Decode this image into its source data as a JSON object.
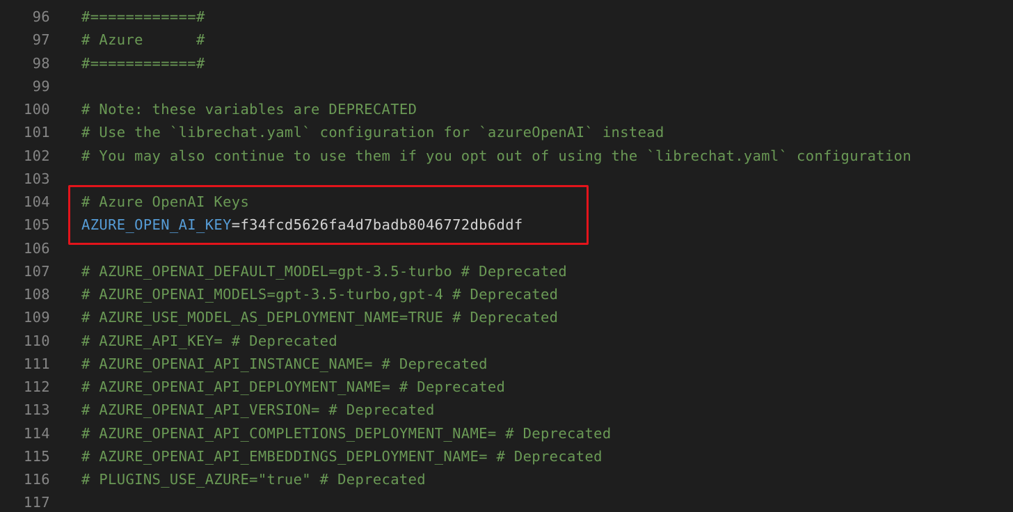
{
  "colors": {
    "background": "#1e1e1e",
    "line_number": "#858585",
    "comment": "#6a9955",
    "variable": "#569cd6",
    "text": "#d4d4d4",
    "highlight_border": "#e3141b"
  },
  "lines": [
    {
      "num": "96",
      "parts": [
        {
          "text": "#============#",
          "kind": "comment"
        }
      ]
    },
    {
      "num": "97",
      "parts": [
        {
          "text": "# Azure      #",
          "kind": "comment"
        }
      ]
    },
    {
      "num": "98",
      "parts": [
        {
          "text": "#============#",
          "kind": "comment"
        }
      ]
    },
    {
      "num": "99",
      "parts": []
    },
    {
      "num": "100",
      "parts": [
        {
          "text": "# Note: these variables are DEPRECATED",
          "kind": "comment"
        }
      ]
    },
    {
      "num": "101",
      "parts": [
        {
          "text": "# Use the `librechat.yaml` configuration for `azureOpenAI` instead",
          "kind": "comment"
        }
      ]
    },
    {
      "num": "102",
      "parts": [
        {
          "text": "# You may also continue to use them if you opt out of using the `librechat.yaml` configuration",
          "kind": "comment"
        }
      ]
    },
    {
      "num": "103",
      "parts": []
    },
    {
      "num": "104",
      "parts": [
        {
          "text": "# Azure OpenAI Keys",
          "kind": "comment"
        }
      ]
    },
    {
      "num": "105",
      "parts": [
        {
          "text": "AZURE_OPEN_AI_KEY",
          "kind": "key"
        },
        {
          "text": "=f34fcd5626fa4d7badb8046772db6ddf",
          "kind": "plain"
        }
      ]
    },
    {
      "num": "106",
      "parts": []
    },
    {
      "num": "107",
      "parts": [
        {
          "text": "# AZURE_OPENAI_DEFAULT_MODEL=gpt-3.5-turbo # Deprecated",
          "kind": "comment"
        }
      ]
    },
    {
      "num": "108",
      "parts": [
        {
          "text": "# AZURE_OPENAI_MODELS=gpt-3.5-turbo,gpt-4 # Deprecated",
          "kind": "comment"
        }
      ]
    },
    {
      "num": "109",
      "parts": [
        {
          "text": "# AZURE_USE_MODEL_AS_DEPLOYMENT_NAME=TRUE # Deprecated",
          "kind": "comment"
        }
      ]
    },
    {
      "num": "110",
      "parts": [
        {
          "text": "# AZURE_API_KEY= # Deprecated",
          "kind": "comment"
        }
      ]
    },
    {
      "num": "111",
      "parts": [
        {
          "text": "# AZURE_OPENAI_API_INSTANCE_NAME= # Deprecated",
          "kind": "comment"
        }
      ]
    },
    {
      "num": "112",
      "parts": [
        {
          "text": "# AZURE_OPENAI_API_DEPLOYMENT_NAME= # Deprecated",
          "kind": "comment"
        }
      ]
    },
    {
      "num": "113",
      "parts": [
        {
          "text": "# AZURE_OPENAI_API_VERSION= # Deprecated",
          "kind": "comment"
        }
      ]
    },
    {
      "num": "114",
      "parts": [
        {
          "text": "# AZURE_OPENAI_API_COMPLETIONS_DEPLOYMENT_NAME= # Deprecated",
          "kind": "comment"
        }
      ]
    },
    {
      "num": "115",
      "parts": [
        {
          "text": "# AZURE_OPENAI_API_EMBEDDINGS_DEPLOYMENT_NAME= # Deprecated",
          "kind": "comment"
        }
      ]
    },
    {
      "num": "116",
      "parts": [
        {
          "text": "# PLUGINS_USE_AZURE=\"true\" # Deprecated",
          "kind": "comment"
        }
      ]
    },
    {
      "num": "117",
      "parts": []
    }
  ]
}
